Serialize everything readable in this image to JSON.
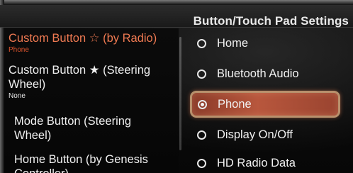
{
  "header": {
    "title": "Button/Touch Pad Settings"
  },
  "settings_list": [
    {
      "label": "Custom Button ☆ (by Radio)",
      "value": "Phone"
    },
    {
      "label_line1": "Custom Button ★ (Steering",
      "label_line2": "Wheel)",
      "value": "None"
    },
    {
      "label_line1": "Mode Button (Steering",
      "label_line2": "Wheel)"
    },
    {
      "label_line1": "Home Button (by Genesis",
      "label_line2": "Controller)"
    }
  ],
  "options": [
    {
      "label": "Home",
      "checked": false
    },
    {
      "label": "Bluetooth Audio",
      "checked": false
    },
    {
      "label": "Phone",
      "checked": true
    },
    {
      "label": "Display On/Off",
      "checked": false
    },
    {
      "label": "HD Radio Data",
      "checked": false
    }
  ],
  "colors": {
    "accent_text": "#f07a52",
    "value_accent": "#e0552e",
    "selection_fill": "#b8573d",
    "selection_border": "#b8906c"
  }
}
